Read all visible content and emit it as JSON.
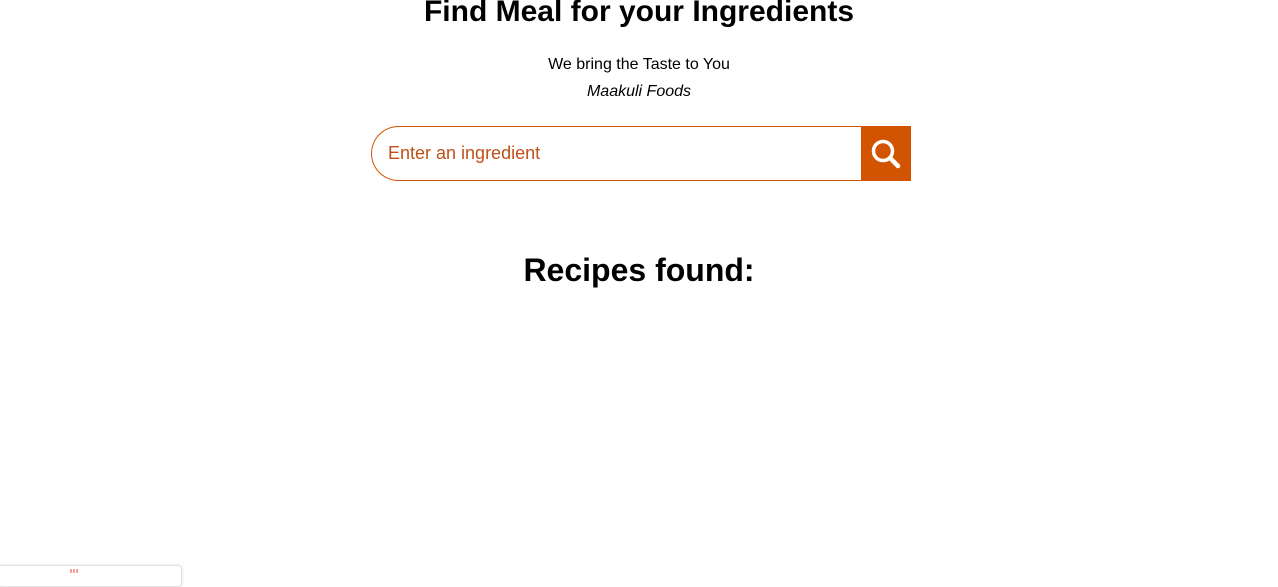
{
  "header": {
    "title": "Find Meal for your Ingredients",
    "tagline": "We bring the Taste to You",
    "brand": "Maakuli Foods"
  },
  "search": {
    "placeholder": "Enter an ingredient",
    "value": "",
    "button_icon": "search-icon"
  },
  "results": {
    "heading": "Recipes found:",
    "items": []
  },
  "colors": {
    "accent": "#d35400",
    "placeholder_text": "#c0501a",
    "background": "#ffffff",
    "text": "#000000"
  }
}
